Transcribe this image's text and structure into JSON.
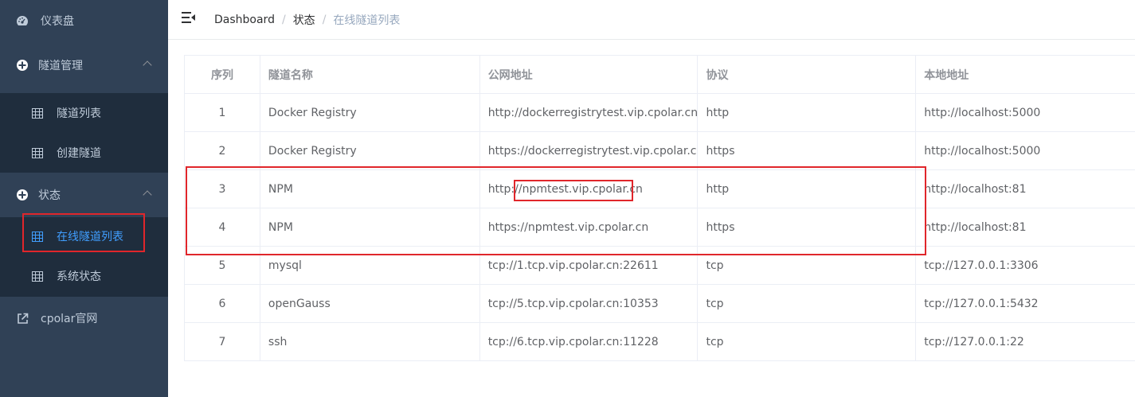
{
  "sidebar": {
    "dashboard_label": "仪表盘",
    "tunnel_mgmt_label": "隧道管理",
    "tunnel_mgmt_children": [
      "隧道列表",
      "创建隧道"
    ],
    "status_label": "状态",
    "status_children": [
      "在线隧道列表",
      "系统状态"
    ],
    "website_label": "cpolar官网",
    "active_item": "在线隧道列表"
  },
  "breadcrumb": [
    "Dashboard",
    "状态",
    "在线隧道列表"
  ],
  "table": {
    "columns": [
      "序列",
      "隧道名称",
      "公网地址",
      "协议",
      "本地地址"
    ],
    "rows": [
      [
        "1",
        "Docker Registry",
        "http://dockerregistrytest.vip.cpolar.cn",
        "http",
        "http://localhost:5000"
      ],
      [
        "2",
        "Docker Registry",
        "https://dockerregistrytest.vip.cpolar.cn",
        "https",
        "http://localhost:5000"
      ],
      [
        "3",
        "NPM",
        "http://npmtest.vip.cpolar.cn",
        "http",
        "http://localhost:81"
      ],
      [
        "4",
        "NPM",
        "https://npmtest.vip.cpolar.cn",
        "https",
        "http://localhost:81"
      ],
      [
        "5",
        "mysql",
        "tcp://1.tcp.vip.cpolar.cn:22611",
        "tcp",
        "tcp://127.0.0.1:3306"
      ],
      [
        "6",
        "openGauss",
        "tcp://5.tcp.vip.cpolar.cn:10353",
        "tcp",
        "tcp://127.0.0.1:5432"
      ],
      [
        "7",
        "ssh",
        "tcp://6.tcp.vip.cpolar.cn:11228",
        "tcp",
        "tcp://127.0.0.1:22"
      ]
    ]
  },
  "colors": {
    "sidebar_bg": "#304156",
    "submenu_bg": "#1f2d3d",
    "sidebar_text": "#bfcbd9",
    "active": "#409eff",
    "annotation_red": "#e0262b"
  }
}
